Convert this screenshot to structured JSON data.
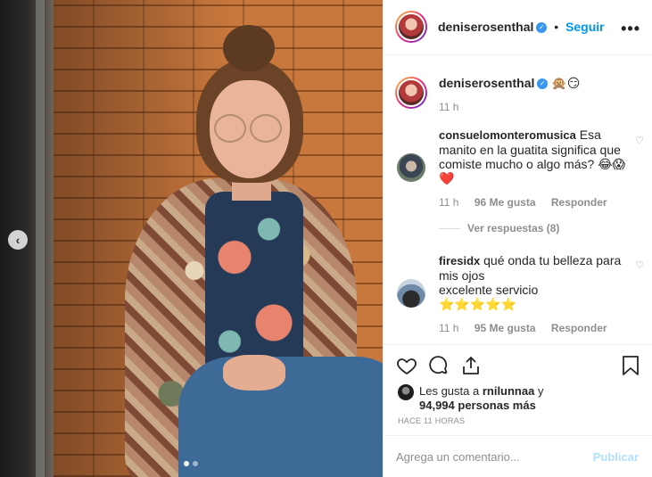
{
  "post": {
    "carousel": {
      "prev_icon": "chevron-left-icon",
      "dots": 2,
      "active_dot": 1
    }
  },
  "header": {
    "username": "deniserosenthal",
    "verified_icon": "verified-badge-icon",
    "follow_label": "Seguir",
    "more_label": "•••"
  },
  "caption": {
    "username": "deniserosenthal",
    "text": "🙊😏",
    "time": "11 h"
  },
  "comments": [
    {
      "username": "consuelomonteromusica",
      "text": "Esa manito en la guatita significa que comiste mucho o algo más? 😂😱 ❤️",
      "time": "11 h",
      "likes": "96 Me gusta",
      "reply": "Responder",
      "view_replies": "Ver respuestas (8)"
    },
    {
      "username": "firesidx",
      "text_line1": "qué onda tu belleza para mis ojos",
      "text_line2": "excelente servicio",
      "text_line3": "⭐⭐⭐⭐⭐",
      "time": "11 h",
      "likes": "95 Me gusta",
      "reply": "Responder"
    }
  ],
  "actions": {
    "like_icon": "heart-icon",
    "comment_icon": "comment-icon",
    "share_icon": "share-icon",
    "save_icon": "bookmark-icon"
  },
  "likes": {
    "prefix": "Les gusta a ",
    "user": "rnilunnaa",
    "middle": " y ",
    "count": "94,994 personas más"
  },
  "time_ago": "HACE 11 HORAS",
  "add_comment": {
    "placeholder": "Agrega un comentario...",
    "publish_label": "Publicar"
  },
  "colors": {
    "accent": "#0095f6",
    "verified": "#3897f0",
    "muted": "#8e8e8e",
    "publish_disabled": "#b2dffc"
  }
}
